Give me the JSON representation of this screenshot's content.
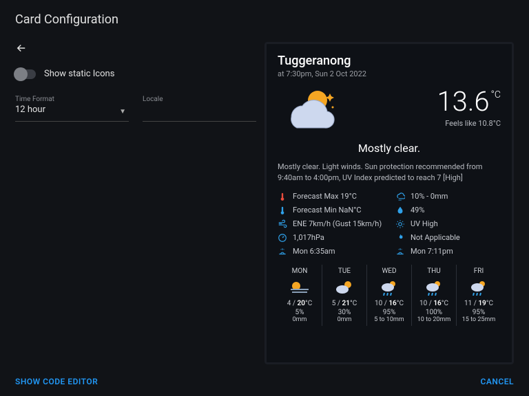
{
  "header": {
    "title": "Card Configuration"
  },
  "toggle": {
    "label": "Show static Icons"
  },
  "fields": {
    "time_format": {
      "label": "Time Format",
      "value": "12 hour"
    },
    "locale": {
      "label": "Locale",
      "value": ""
    }
  },
  "weather": {
    "location": "Tuggeranong",
    "timestamp": "at 7:30pm, Sun 2 Oct 2022",
    "temp": "13.6",
    "temp_unit": "°C",
    "feels_like": "Feels like 10.8°C",
    "condition": "Mostly clear.",
    "description": "Mostly clear. Light winds. Sun protection recommended from 9:40am to 4:00pm, UV Index predicted to reach 7 [High]",
    "stats": {
      "forecast_max": "Forecast Max 19°C",
      "rain_chance": "10% - 0mm",
      "forecast_min": "Forecast Min NaN°C",
      "humidity": "49%",
      "wind": "ENE 7km/h (Gust 15km/h)",
      "uv": "UV High",
      "pressure": "1,017hPa",
      "fire": "Not Applicable",
      "sunrise": "Mon 6:35am",
      "sunset": "Mon 7:11pm"
    },
    "forecast": [
      {
        "name": "MON",
        "icon": "fog",
        "lo": "4",
        "hi": "20",
        "pct": "5%",
        "rain": "0mm"
      },
      {
        "name": "TUE",
        "icon": "pc",
        "lo": "5",
        "hi": "21",
        "pct": "30%",
        "rain": "0mm"
      },
      {
        "name": "WED",
        "icon": "rain",
        "lo": "10",
        "hi": "16",
        "pct": "95%",
        "rain": "5 to 10mm"
      },
      {
        "name": "THU",
        "icon": "rain",
        "lo": "10",
        "hi": "16",
        "pct": "100%",
        "rain": "10 to 20mm"
      },
      {
        "name": "FRI",
        "icon": "rain",
        "lo": "11",
        "hi": "19",
        "pct": "95%",
        "rain": "15 to 25mm"
      }
    ]
  },
  "footer": {
    "code_editor": "SHOW CODE EDITOR",
    "cancel": "CANCEL"
  }
}
